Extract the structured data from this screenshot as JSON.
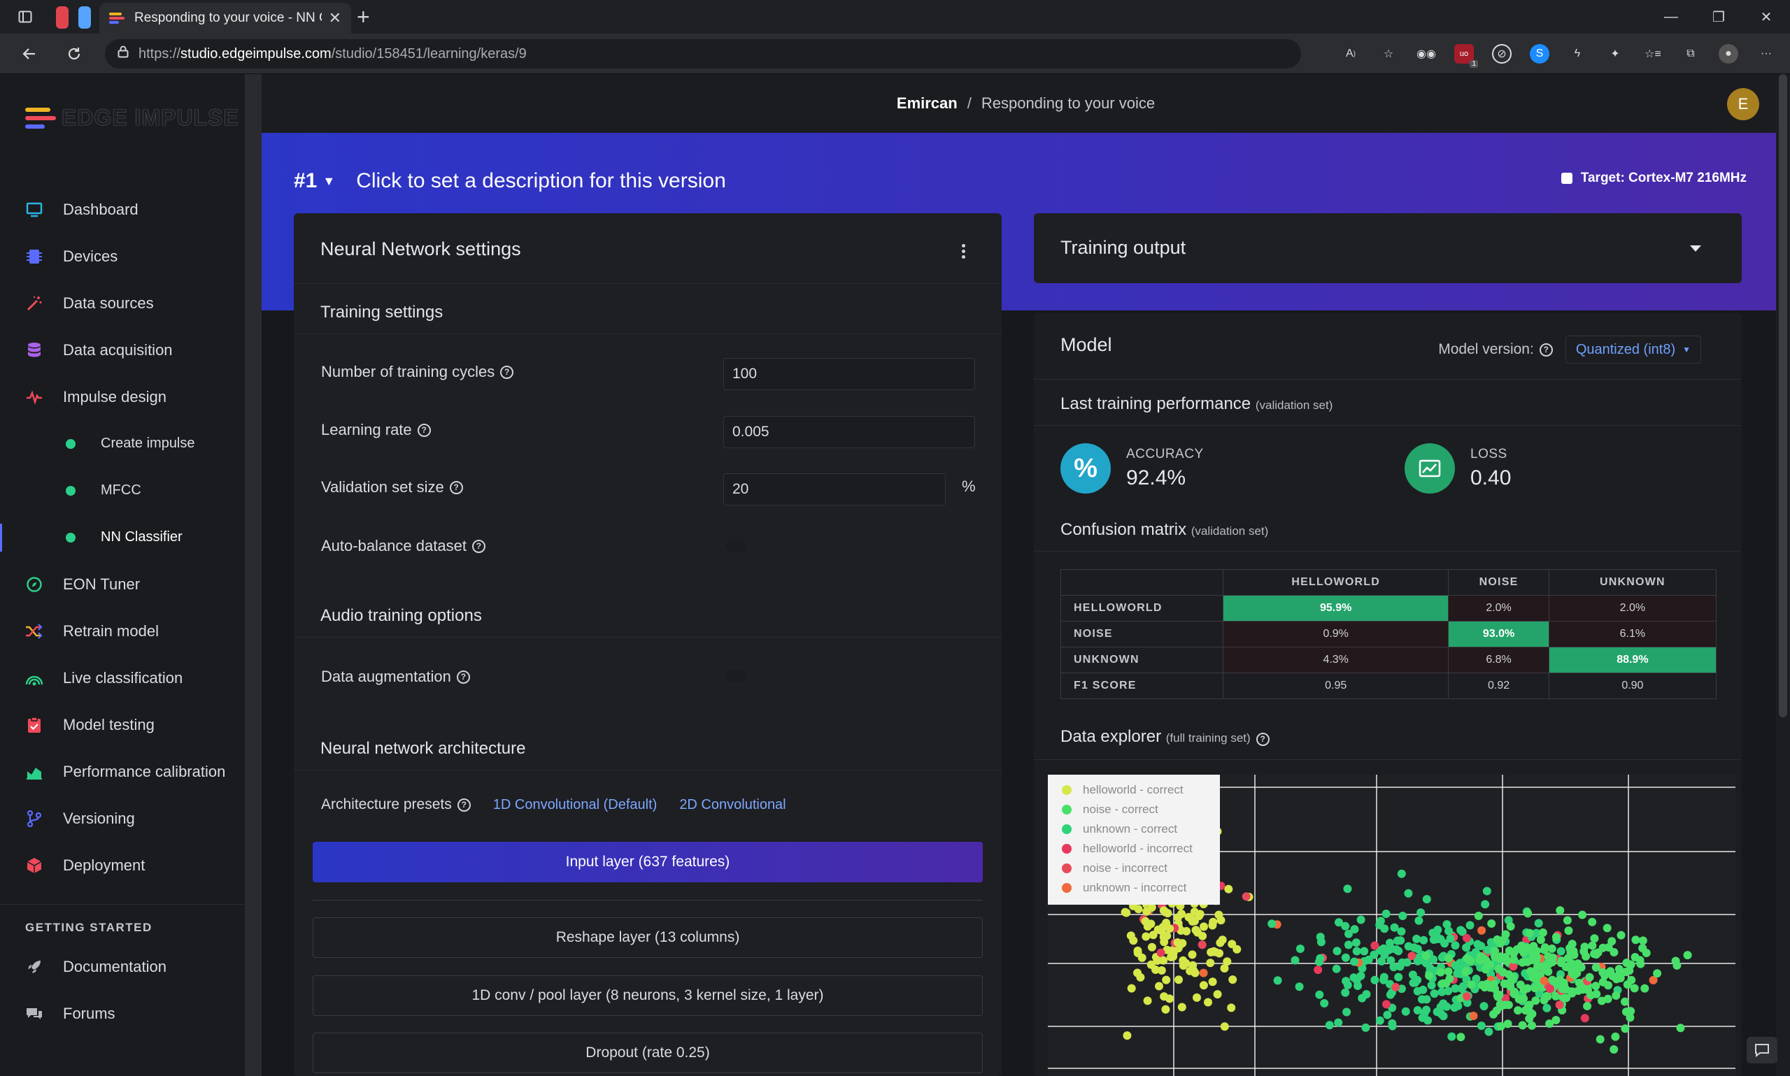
{
  "browser": {
    "tab_title": "Responding to your voice - NN C",
    "url_prefix": "https://",
    "url_host": "studio.edgeimpulse.com",
    "url_path": "/studio/158451/learning/keras/9",
    "colors": {
      "chrome": "#1f2023",
      "active_tab": "#2c2d31"
    },
    "extension_icons": [
      "read-aloud-icon",
      "favorite-add-icon",
      "glasses-icon",
      "ublock-icon",
      "privacy-icon",
      "shazam-icon",
      "feather-icon",
      "puzzle-icon",
      "favorites-icon",
      "collections-icon",
      "profile-icon",
      "more-icon"
    ],
    "ublock_badge": "1"
  },
  "sidebar": {
    "logo_text": "EDGE IMPULSE",
    "items": [
      {
        "label": "Dashboard",
        "icon": "monitor-icon",
        "color": "#2bb3e6"
      },
      {
        "label": "Devices",
        "icon": "chip-icon",
        "color": "#5b6bff"
      },
      {
        "label": "Data sources",
        "icon": "wand-icon",
        "color": "#ef4a5a"
      },
      {
        "label": "Data acquisition",
        "icon": "database-icon",
        "color": "#a962e8"
      },
      {
        "label": "Impulse design",
        "icon": "pulse-icon",
        "color": "#ef4a5a"
      }
    ],
    "sub_items": [
      {
        "label": "Create impulse"
      },
      {
        "label": "MFCC"
      },
      {
        "label": "NN Classifier"
      }
    ],
    "items2": [
      {
        "label": "EON Tuner",
        "icon": "compass-icon",
        "color": "#2ad08a"
      },
      {
        "label": "Retrain model",
        "icon": "shuffle-icon",
        "color": "#f0b323"
      },
      {
        "label": "Live classification",
        "icon": "signal-icon",
        "color": "#2ad08a"
      },
      {
        "label": "Model testing",
        "icon": "clipboard-icon",
        "color": "#ef4a5a"
      },
      {
        "label": "Performance calibration",
        "icon": "chart-icon",
        "color": "#2ad08a"
      },
      {
        "label": "Versioning",
        "icon": "branch-icon",
        "color": "#5b6bff"
      },
      {
        "label": "Deployment",
        "icon": "cube-icon",
        "color": "#ef4a5a"
      }
    ],
    "getting_started": "GETTING STARTED",
    "help_items": [
      {
        "label": "Documentation",
        "icon": "rocket-icon"
      },
      {
        "label": "Forums",
        "icon": "chat-icon"
      }
    ]
  },
  "topbar": {
    "owner": "Emircan",
    "separator": "/",
    "project": "Responding to your voice",
    "avatar_letter": "E"
  },
  "banner": {
    "version": "#1",
    "description": "Click to set a description for this version",
    "target": "Target: Cortex-M7 216MHz"
  },
  "nn": {
    "title": "Neural Network settings",
    "training_settings": "Training settings",
    "cycles_label": "Number of training cycles",
    "cycles_value": "100",
    "lr_label": "Learning rate",
    "lr_value": "0.005",
    "val_label": "Validation set size",
    "val_value": "20",
    "val_unit": "%",
    "autobalance_label": "Auto-balance dataset",
    "audio_options": "Audio training options",
    "augmentation_label": "Data augmentation",
    "arch_title": "Neural network architecture",
    "presets_label": "Architecture presets",
    "preset_1d": "1D Convolutional (Default)",
    "preset_2d": "2D Convolutional",
    "layers": [
      "Input layer (637 features)",
      "Reshape layer (13 columns)",
      "1D conv / pool layer (8 neurons, 3 kernel size, 1 layer)",
      "Dropout (rate 0.25)"
    ]
  },
  "training_output": {
    "title": "Training output"
  },
  "model": {
    "title": "Model",
    "version_label": "Model version:",
    "version_value": "Quantized (int8)",
    "perf_title": "Last training performance",
    "perf_note": "(validation set)",
    "accuracy_label": "ACCURACY",
    "accuracy_value": "92.4%",
    "loss_label": "LOSS",
    "loss_value": "0.40",
    "cm_title": "Confusion matrix",
    "cm_note": "(validation set)",
    "cm_cols": [
      "HELLOWORLD",
      "NOISE",
      "UNKNOWN"
    ],
    "cm_rows": [
      {
        "label": "HELLOWORLD",
        "cells": [
          "95.9%",
          "2.0%",
          "2.0%"
        ],
        "hi": 0
      },
      {
        "label": "NOISE",
        "cells": [
          "0.9%",
          "93.0%",
          "6.1%"
        ],
        "hi": 1
      },
      {
        "label": "UNKNOWN",
        "cells": [
          "4.3%",
          "6.8%",
          "88.9%"
        ],
        "hi": 2
      },
      {
        "label": "F1 SCORE",
        "cells": [
          "0.95",
          "0.92",
          "0.90"
        ],
        "hi": -1
      }
    ],
    "explorer_title": "Data explorer",
    "explorer_note": "(full training set)",
    "legend": [
      {
        "label": "helloworld - correct",
        "color": "#d6e74a"
      },
      {
        "label": "noise - correct",
        "color": "#49e06a"
      },
      {
        "label": "unknown - correct",
        "color": "#2fd27a"
      },
      {
        "label": "helloworld - incorrect",
        "color": "#e63a5c"
      },
      {
        "label": "noise - incorrect",
        "color": "#e84a5a"
      },
      {
        "label": "unknown - incorrect",
        "color": "#ef6a3a"
      }
    ]
  }
}
